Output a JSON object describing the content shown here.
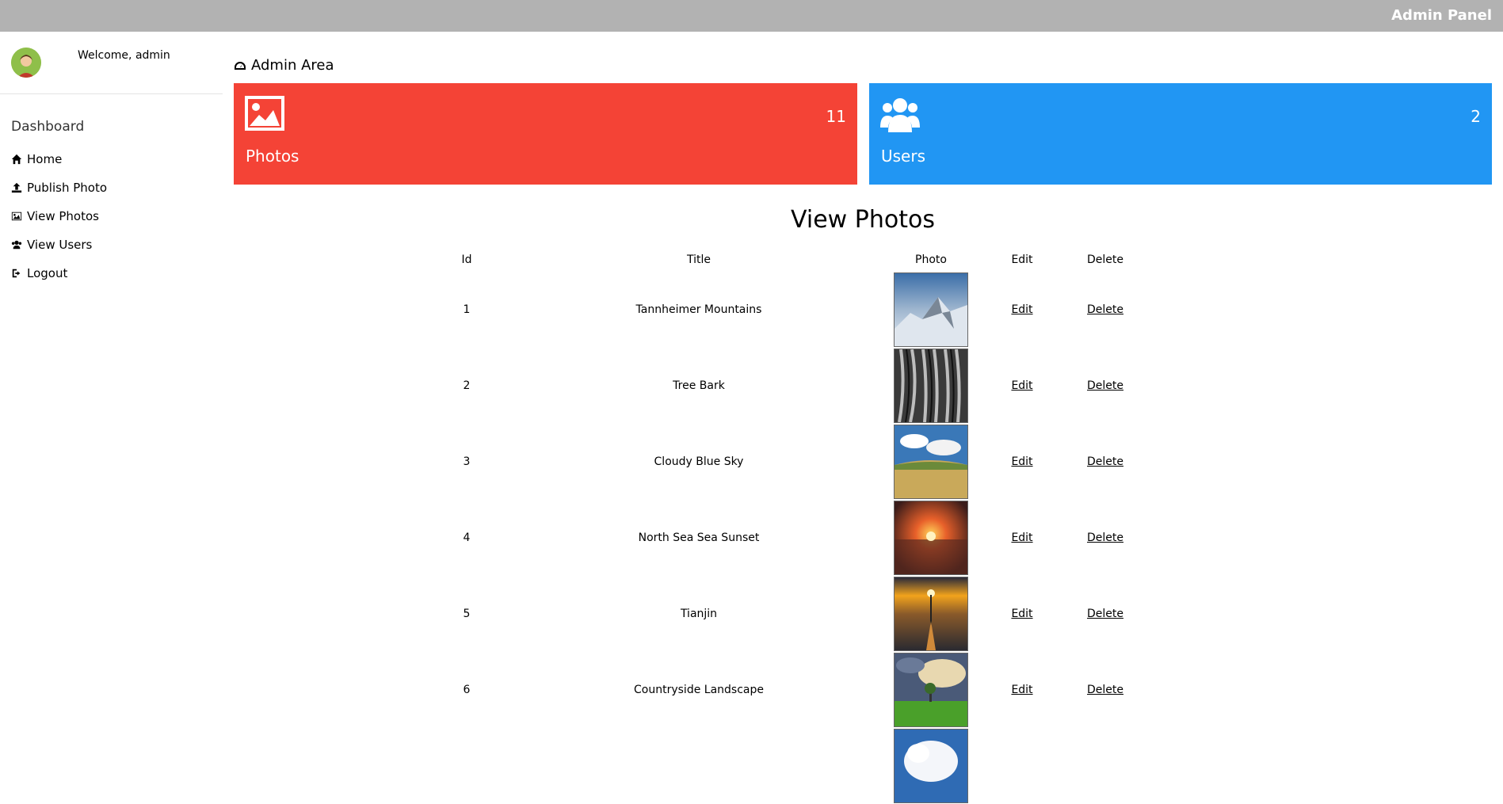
{
  "header": {
    "brand": "Admin Panel"
  },
  "sidebar": {
    "welcome": "Welcome, admin",
    "section_title": "Dashboard",
    "items": [
      {
        "label": "Home",
        "icon": "home-icon"
      },
      {
        "label": "Publish Photo",
        "icon": "upload-icon"
      },
      {
        "label": "View Photos",
        "icon": "image-icon"
      },
      {
        "label": "View Users",
        "icon": "users-icon"
      },
      {
        "label": "Logout",
        "icon": "sign-out-icon"
      }
    ]
  },
  "main": {
    "area_title": "Admin Area",
    "cards": {
      "photos": {
        "label": "Photos",
        "count": "11",
        "color": "#f44336"
      },
      "users": {
        "label": "Users",
        "count": "2",
        "color": "#2196f3"
      }
    },
    "section_title": "View Photos",
    "table": {
      "headers": [
        "Id",
        "Title",
        "Photo",
        "Edit",
        "Delete"
      ],
      "rows": [
        {
          "id": "1",
          "title": "Tannheimer Mountains",
          "edit": "Edit",
          "delete": "Delete"
        },
        {
          "id": "2",
          "title": "Tree Bark",
          "edit": "Edit",
          "delete": "Delete"
        },
        {
          "id": "3",
          "title": "Cloudy Blue Sky",
          "edit": "Edit",
          "delete": "Delete"
        },
        {
          "id": "4",
          "title": "North Sea Sea Sunset",
          "edit": "Edit",
          "delete": "Delete"
        },
        {
          "id": "5",
          "title": "Tianjin",
          "edit": "Edit",
          "delete": "Delete"
        },
        {
          "id": "6",
          "title": "Countryside Landscape",
          "edit": "Edit",
          "delete": "Delete"
        },
        {
          "id": "",
          "title": "",
          "edit": "",
          "delete": ""
        }
      ]
    }
  }
}
